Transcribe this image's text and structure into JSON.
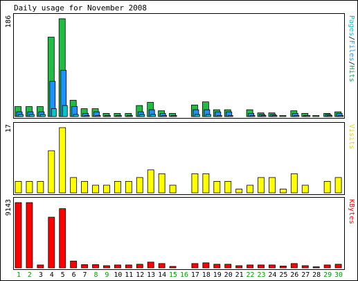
{
  "chart_data": {
    "type": "bar",
    "title": "Daily usage for November 2008",
    "categories": [
      "1",
      "2",
      "3",
      "4",
      "5",
      "6",
      "7",
      "8",
      "9",
      "10",
      "11",
      "12",
      "13",
      "14",
      "15",
      "16",
      "17",
      "18",
      "19",
      "20",
      "21",
      "22",
      "23",
      "24",
      "25",
      "26",
      "27",
      "28",
      "29",
      "30"
    ],
    "weekend_days": [
      "1",
      "2",
      "8",
      "9",
      "15",
      "16",
      "22",
      "23",
      "29",
      "30"
    ],
    "panels": [
      {
        "name": "hits-files-pages",
        "scale_max_label": "186",
        "ylim": [
          0,
          186
        ],
        "legend_parts": [
          {
            "text": "Pages",
            "color": "#00c8c8"
          },
          {
            "text": "/",
            "color": "#000000"
          },
          {
            "text": "Files",
            "color": "#1e90ff"
          },
          {
            "text": "/",
            "color": "#000000"
          },
          {
            "text": "Hits",
            "color": "#00b050"
          }
        ],
        "series": [
          {
            "name": "Hits",
            "color": "#22bb44",
            "values": [
              19,
              19,
              19,
              151,
              186,
              31,
              15,
              15,
              6,
              6,
              6,
              21,
              27,
              11,
              6,
              0,
              22,
              28,
              13,
              13,
              0,
              13,
              7,
              7,
              2,
              11,
              6,
              2,
              6,
              9
            ]
          },
          {
            "name": "Files",
            "color": "#1e90ff",
            "values": [
              9,
              9,
              9,
              67,
              88,
              19,
              6,
              9,
              2,
              2,
              2,
              9,
              13,
              6,
              2,
              0,
              13,
              13,
              9,
              9,
              0,
              6,
              4,
              4,
              0,
              6,
              2,
              0,
              4,
              6
            ]
          },
          {
            "name": "Pages",
            "color": "#00c8c8",
            "values": [
              4,
              4,
              4,
              15,
              21,
              4,
              2,
              2,
              0,
              0,
              0,
              4,
              4,
              2,
              0,
              0,
              4,
              4,
              2,
              2,
              0,
              2,
              2,
              2,
              0,
              2,
              2,
              0,
              2,
              2
            ]
          }
        ]
      },
      {
        "name": "visits",
        "scale_max_label": "17",
        "ylim": [
          0,
          17
        ],
        "legend_parts": [
          {
            "text": "Visits",
            "color": "#dddd00"
          }
        ],
        "series": [
          {
            "name": "Visits",
            "color": "#ffff00",
            "values": [
              3,
              3,
              3,
              11,
              17,
              4,
              3,
              2,
              2,
              3,
              3,
              4,
              6,
              5,
              2,
              0,
              5,
              5,
              3,
              3,
              1,
              2,
              4,
              4,
              1,
              5,
              2,
              0,
              3,
              4
            ]
          }
        ]
      },
      {
        "name": "kbytes",
        "scale_max_label": "9143",
        "ylim": [
          0,
          9143
        ],
        "legend_parts": [
          {
            "text": "KBytes",
            "color": "#ff0000"
          }
        ],
        "series": [
          {
            "name": "KBytes",
            "color": "#ff0000",
            "values": [
              9143,
              9143,
              400,
              7100,
              8300,
              950,
              450,
              450,
              300,
              400,
              400,
              500,
              800,
              600,
              200,
              0,
              600,
              700,
              500,
              500,
              300,
              400,
              400,
              400,
              250,
              600,
              300,
              100,
              400,
              500
            ]
          }
        ]
      }
    ]
  }
}
